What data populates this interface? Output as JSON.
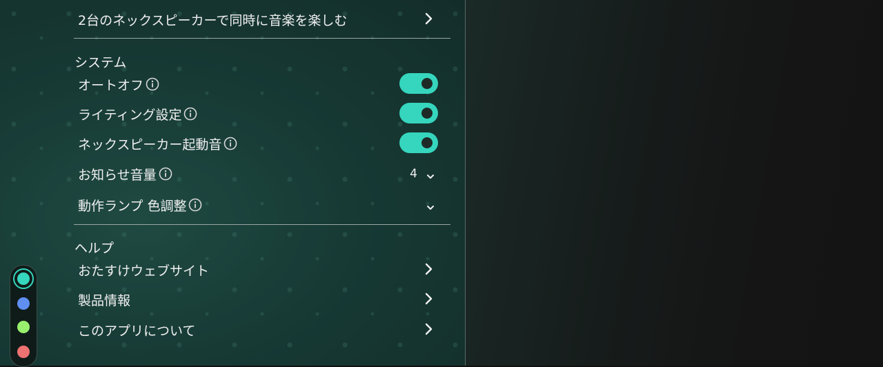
{
  "top_item": {
    "label": "2台のネックスピーカーで同時に音楽を楽しむ"
  },
  "system": {
    "title": "システム",
    "items": [
      {
        "label": "オートオフ",
        "state": "on"
      },
      {
        "label": "ライティング設定",
        "state": "on"
      },
      {
        "label": "ネックスピーカー起動音",
        "state": "on"
      },
      {
        "label": "お知らせ音量",
        "value": "4"
      },
      {
        "label": "動作ランプ 色調整",
        "value": ""
      }
    ]
  },
  "help": {
    "title": "ヘルプ",
    "items": [
      {
        "label": "おたすけウェブサイト"
      },
      {
        "label": "製品情報"
      },
      {
        "label": "このアプリについて"
      }
    ]
  },
  "colors": {
    "accent": "#35d6bd",
    "swatches": [
      "#35d6bd",
      "#5f8ff0",
      "#98ef6e",
      "#ef7272"
    ]
  }
}
